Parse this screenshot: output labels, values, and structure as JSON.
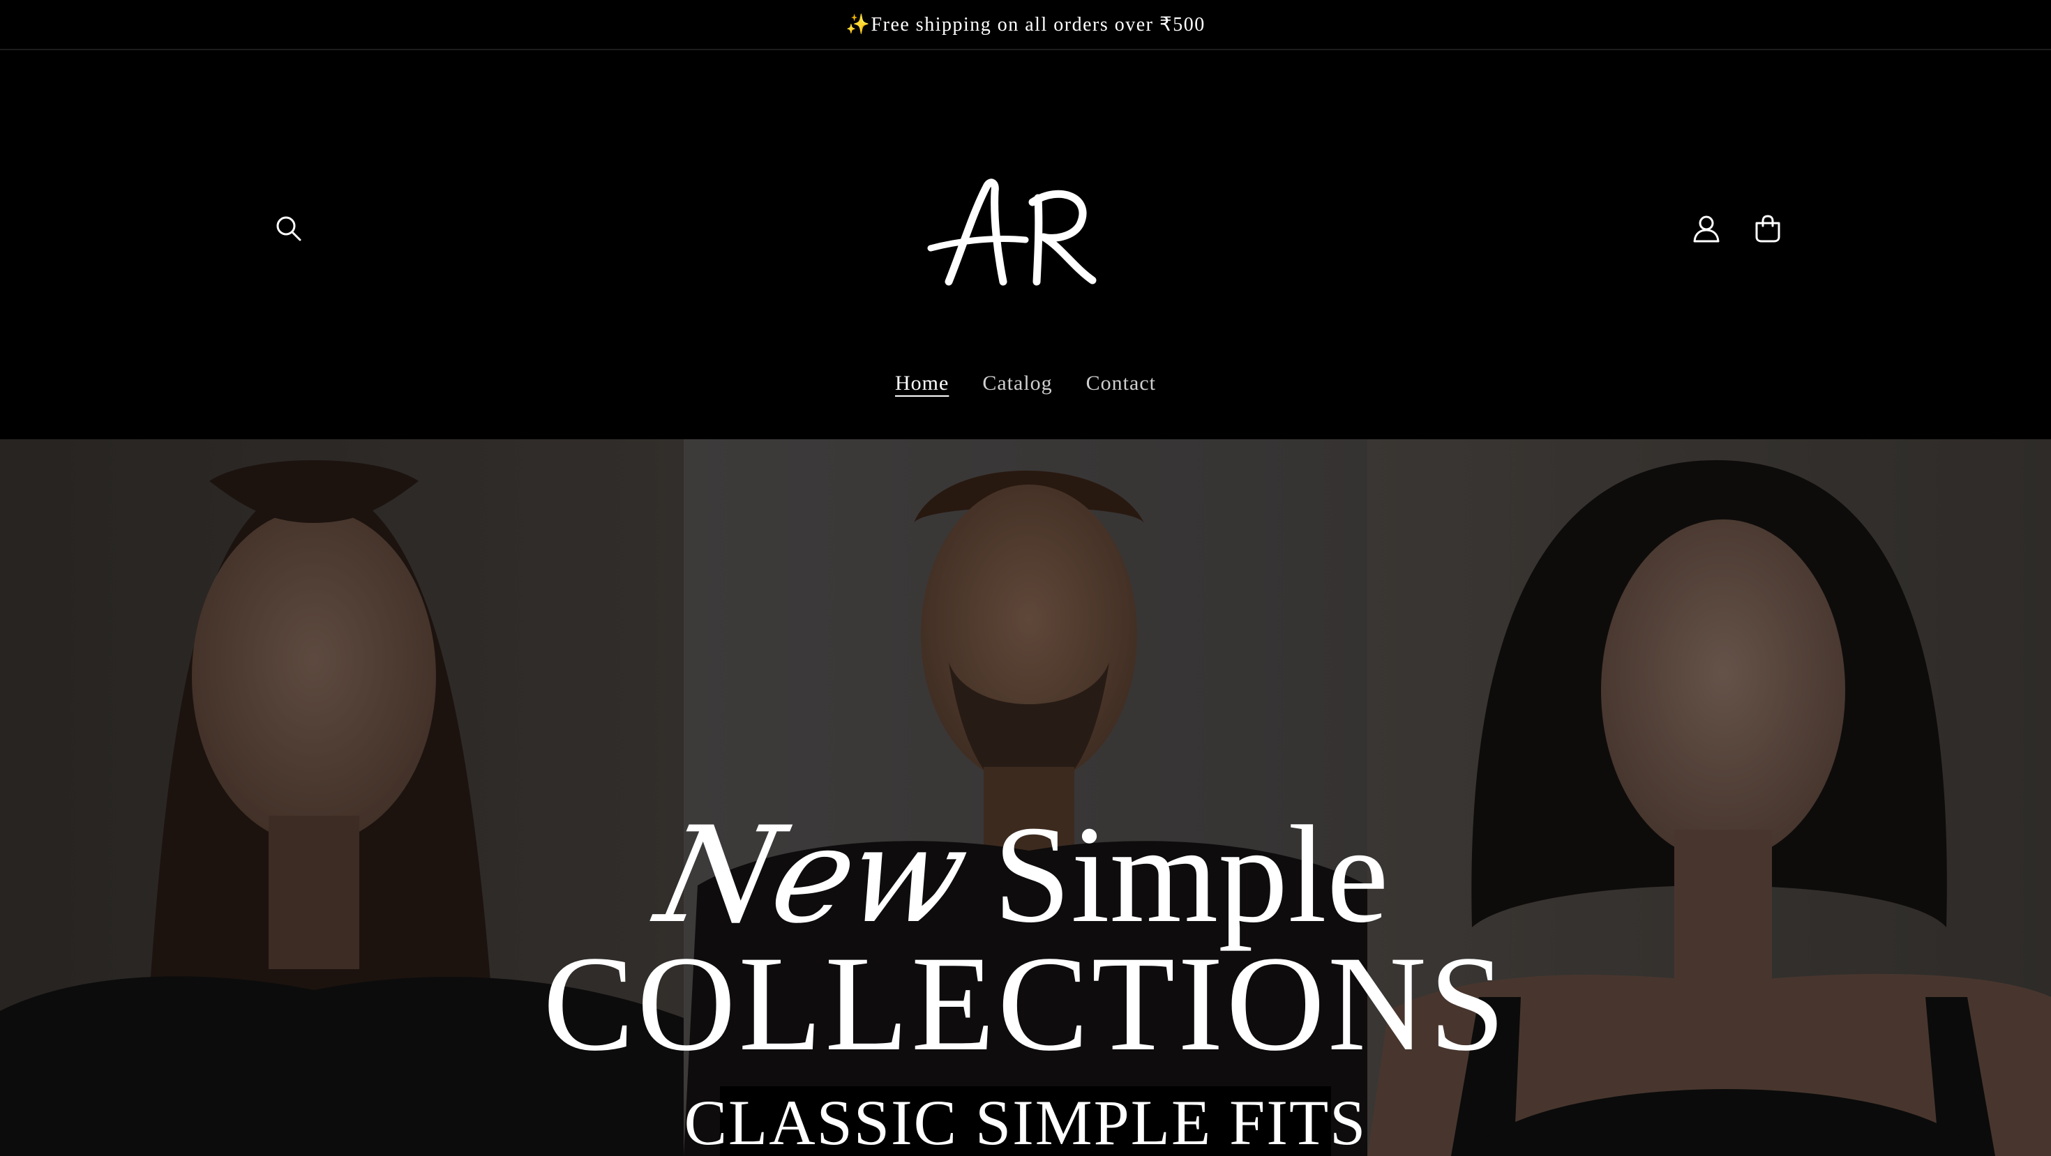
{
  "announcement": {
    "text": "✨Free shipping on all orders over ₹500"
  },
  "header": {
    "logo_text": "AR",
    "icons": {
      "search": "search-icon",
      "account": "user-icon",
      "cart": "shopping-bag-icon"
    }
  },
  "nav": {
    "items": [
      {
        "label": "Home",
        "active": true
      },
      {
        "label": "Catalog",
        "active": false
      },
      {
        "label": "Contact",
        "active": false
      }
    ]
  },
  "hero": {
    "headline_script": "New",
    "headline_serif": "Simple",
    "headline_line2": "COLLECTIONS",
    "subheading": "CLASSIC SIMPLE FITS"
  },
  "colors": {
    "background": "#000000",
    "text": "#ffffff",
    "nav_inactive": "#cfcfcf"
  }
}
